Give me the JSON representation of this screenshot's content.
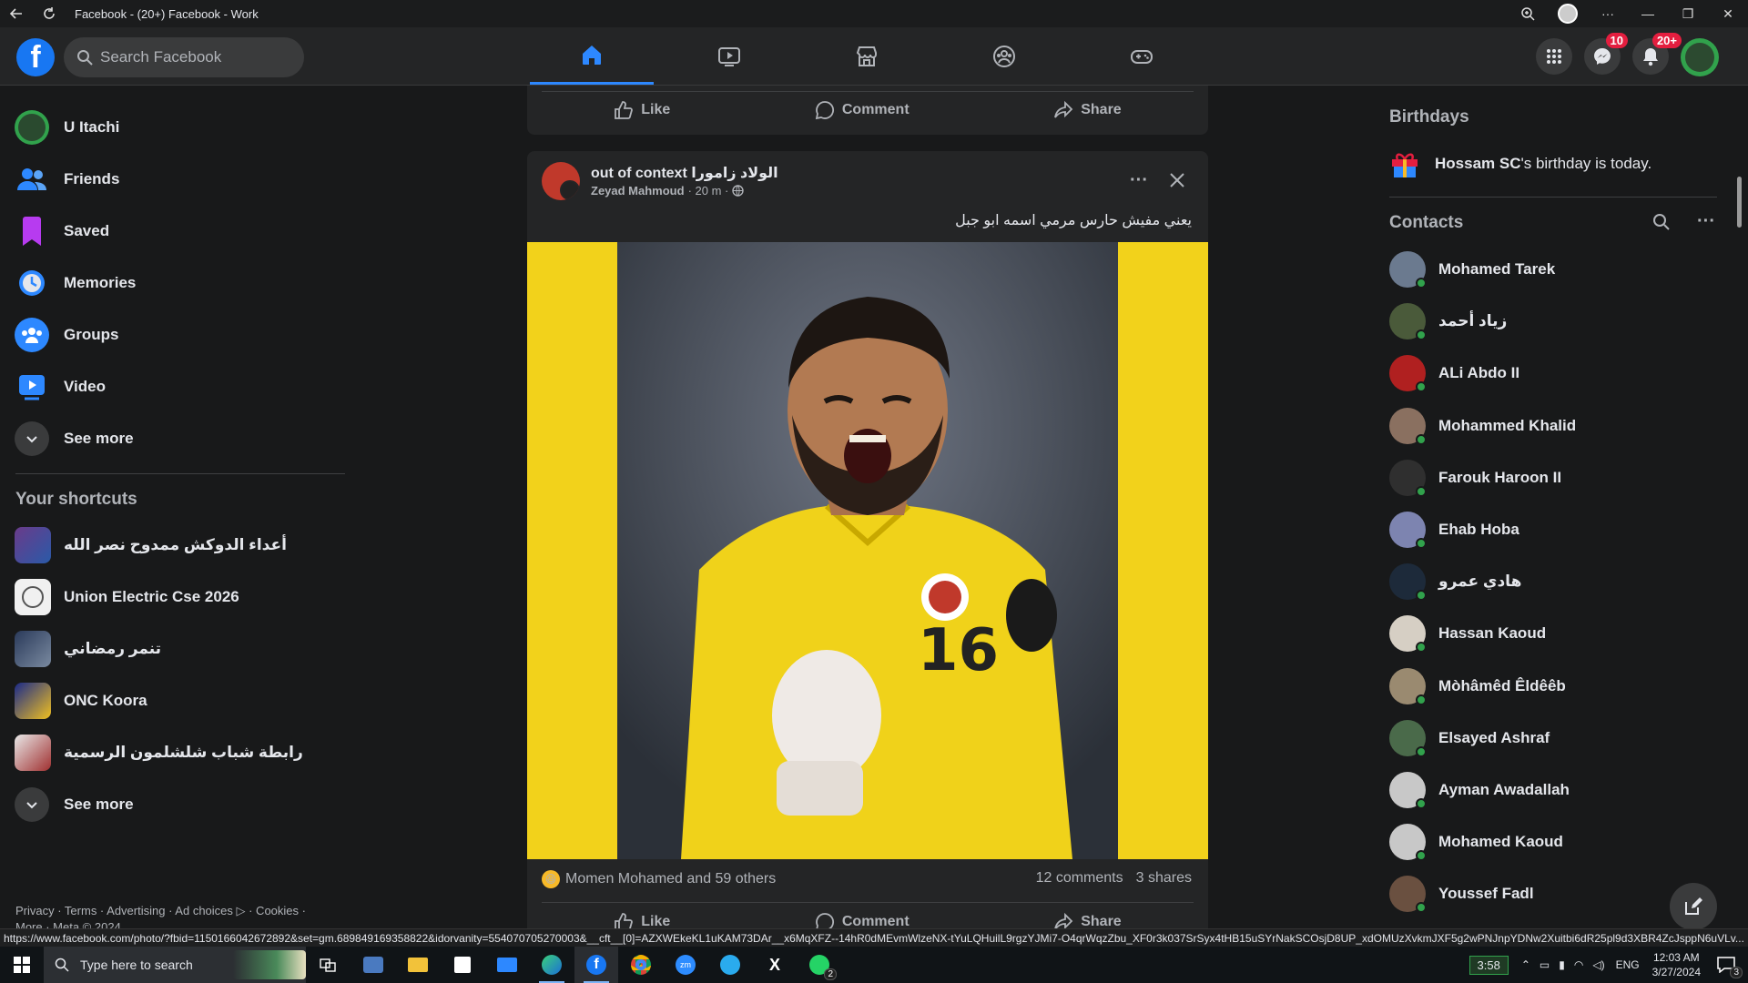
{
  "window": {
    "title": "Facebook - (20+) Facebook - Work"
  },
  "topbar": {
    "logo": "f",
    "search_placeholder": "Search Facebook",
    "tabs": [
      "home-icon",
      "watch-icon",
      "marketplace-icon",
      "groups-icon",
      "gaming-icon"
    ],
    "messenger_badge": "10",
    "notifications_badge": "20+"
  },
  "sidebar": {
    "items": [
      {
        "label": "U Itachi",
        "icon": "profile-avatar"
      },
      {
        "label": "Friends",
        "icon": "friends-icon"
      },
      {
        "label": "Saved",
        "icon": "saved-icon"
      },
      {
        "label": "Memories",
        "icon": "memories-icon"
      },
      {
        "label": "Groups",
        "icon": "groups-icon"
      },
      {
        "label": "Video",
        "icon": "video-icon"
      }
    ],
    "see_more": "See more",
    "shortcuts_title": "Your shortcuts",
    "shortcuts": [
      {
        "label": "أعداء الدوكش ممدوح نصر الله"
      },
      {
        "label": "Union Electric Cse 2026"
      },
      {
        "label": "تنمر رمضاني"
      },
      {
        "label": "ONC Koora"
      },
      {
        "label": "رابطة شباب شلشلمون الرسمية"
      }
    ],
    "shortcuts_see_more": "See more",
    "footer_line1": "Privacy · Terms · Advertising · Ad choices ▷ · Cookies ·",
    "footer_line2": "More · Meta © 2024"
  },
  "prev_post": {
    "like": "Like",
    "comment": "Comment",
    "share": "Share"
  },
  "post": {
    "group_name": "out of context الولاد زامورا",
    "author": "Zeyad Mahmoud",
    "time": "· 20 m ·",
    "caption": "يعني مفيش حارس مرمي اسمه ابو جبل",
    "jersey_number": "16",
    "reactions_text": "Momen Mohamed and 59 others",
    "comments": "12 comments",
    "shares": "3 shares",
    "like": "Like",
    "comment": "Comment",
    "share": "Share"
  },
  "right": {
    "birthdays_title": "Birthdays",
    "birthday_name": "Hossam SC",
    "birthday_rest": "'s birthday is today.",
    "contacts_title": "Contacts",
    "contacts": [
      {
        "name": "Mohamed Tarek",
        "color": "#6b7a8f"
      },
      {
        "name": "زياد أحمد",
        "color": "#4a5a3a"
      },
      {
        "name": "ALi Abdo II",
        "color": "#b02020"
      },
      {
        "name": "Mohammed Khalid",
        "color": "#8a7060"
      },
      {
        "name": "Farouk Haroon II",
        "color": "#2f2f2f"
      },
      {
        "name": "Ehab Hoba",
        "color": "#7d84b0"
      },
      {
        "name": "هادي عمرو",
        "color": "#1d2a3a"
      },
      {
        "name": "Hassan Kaoud",
        "color": "#d6cfc4"
      },
      {
        "name": "Mòhâmêd Êldêêb",
        "color": "#9a8a70"
      },
      {
        "name": "Elsayed Ashraf",
        "color": "#4a6a4a"
      },
      {
        "name": "Ayman Awadallah",
        "color": "#c8c8c8"
      },
      {
        "name": "Mohamed Kaoud",
        "color": "#c8c8c8"
      },
      {
        "name": "Youssef Fadl",
        "color": "#6a5040"
      }
    ]
  },
  "statusbar": {
    "url": "https://www.facebook.com/photo/?fbid=1150166042672892&set=gm.689849169358822&idorvanity=554070705270003&__cft__[0]=AZXWEkeKL1uKAM73DAr__x6MqXFZ--14hR0dMEvmWlzeNX-tYuLQHuilL9rgzYJMi7-O4qrWqzZbu_XF0r3k037SrSyx4tHB15uSYrNakSCOsjD8UP_xdOMUzXvkmJXF5g2wPNJnpYDNw2Xuitbi6dR25pl9d3XBR4ZcJsppN6uVLv..."
  },
  "taskbar": {
    "search_placeholder": "Type here to search",
    "timer": "3:58",
    "lang": "ENG",
    "time": "12:03 AM",
    "date": "3/27/2024",
    "whatsapp_badge": "2",
    "notif_badge": "3"
  },
  "colors": {
    "fb_blue": "#1877f2",
    "bg": "#18191a",
    "card": "#242526",
    "online": "#31a24c",
    "jersey": "#f2d21b"
  }
}
